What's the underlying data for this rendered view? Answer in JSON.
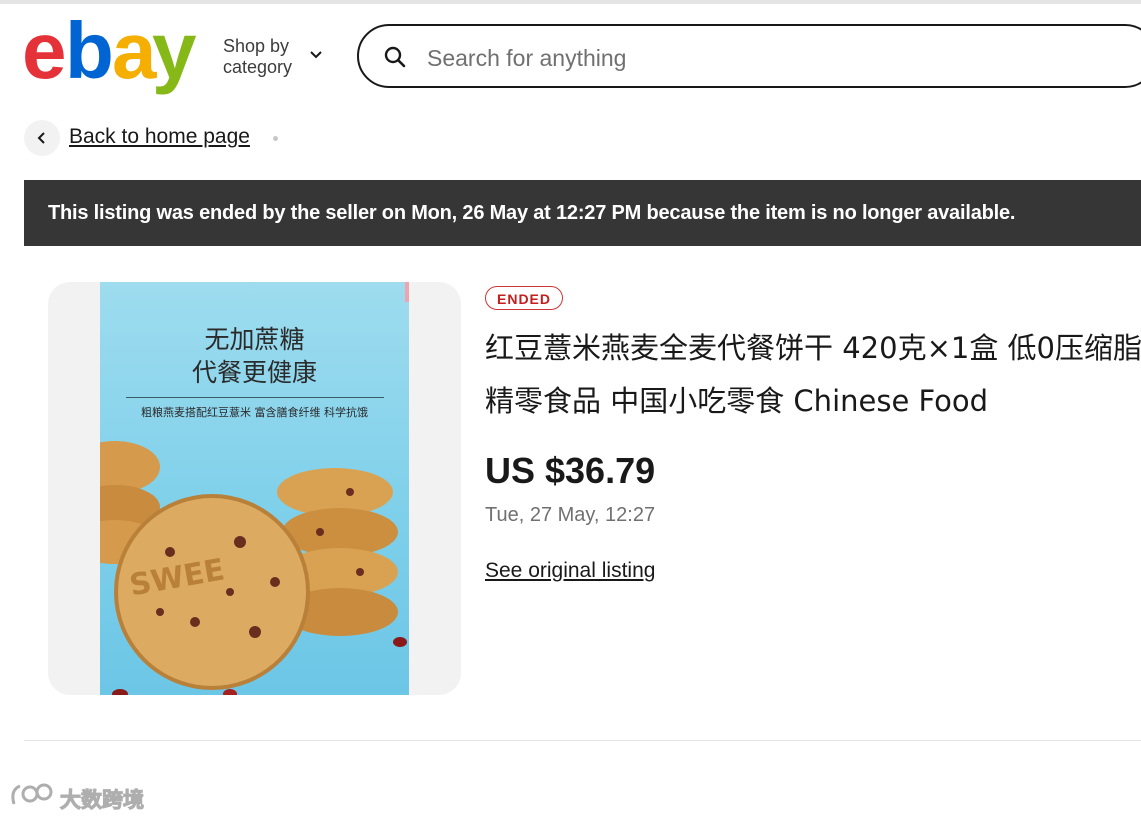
{
  "header": {
    "logo_letters": [
      "e",
      "b",
      "a",
      "y"
    ],
    "logo_colors": [
      "#e53238",
      "#0064d2",
      "#f5af02",
      "#86b817"
    ],
    "shop_by_label": "Shop by category",
    "search_placeholder": "Search for anything"
  },
  "nav": {
    "back_label": "Back to home page"
  },
  "banner": {
    "text": "This listing was ended by the seller on Mon, 26 May at 12:27 PM because the item is no longer available."
  },
  "product_image": {
    "headline_line1": "无加蔗糖",
    "headline_line2": "代餐更健康",
    "subline": "粗粮燕麦搭配红豆薏米  富含膳食纤维  科学抗饿",
    "cookie_text": "SWEE"
  },
  "listing": {
    "status_badge": "ENDED",
    "title": "红豆薏米燕麦全麦代餐饼干 420克×1盒 低0压缩脂精零食品 中国小吃零食 Chinese Food",
    "price": "US $36.79",
    "ended_date": "Tue, 27 May, 12:27",
    "see_original_label": "See original listing"
  },
  "watermark": {
    "text": "大数跨境"
  },
  "colors": {
    "banner_bg": "#363636",
    "ended_red": "#c41e1e",
    "image_bg": "#7fd0ea"
  }
}
